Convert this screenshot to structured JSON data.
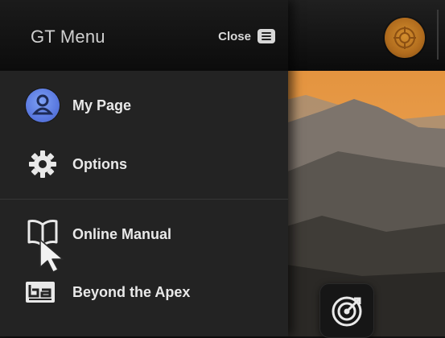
{
  "header": {
    "title": "GT Menu",
    "close_label": "Close"
  },
  "menu": {
    "items": [
      {
        "label": "My Page",
        "icon": "user-avatar-icon"
      },
      {
        "label": "Options",
        "icon": "gear-icon"
      },
      {
        "label": "Online Manual",
        "icon": "book-icon"
      },
      {
        "label": "Beyond the Apex",
        "icon": "beyond-the-apex-logo-icon"
      }
    ]
  },
  "colors": {
    "drawer_bg": "#232323",
    "text": "#e9e9e9",
    "accent_avatar": "#5a79e0",
    "logo_orange": "#b06b1d"
  }
}
